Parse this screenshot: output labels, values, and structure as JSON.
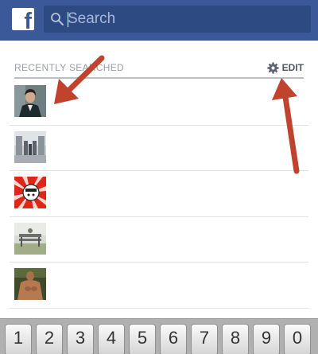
{
  "topbar": {
    "logo_letter": "f",
    "logo_icon": "facebook-logo-icon",
    "search": {
      "placeholder": "Search",
      "icon": "search-icon"
    }
  },
  "recent": {
    "title": "RECENTLY SEARCHED",
    "edit_label": "EDIT",
    "edit_icon": "gear-icon",
    "items": [
      {
        "thumbnail": "person-in-suit-photo"
      },
      {
        "thumbnail": "mirrored-street-photo"
      },
      {
        "thumbnail": "red-rays-cartoon-photo"
      },
      {
        "thumbnail": "outdoor-bench-photo"
      },
      {
        "thumbnail": "shirtless-person-photo"
      }
    ]
  },
  "keyboard": {
    "keys": [
      "1",
      "2",
      "3",
      "4",
      "5",
      "6",
      "7",
      "8",
      "9",
      "0"
    ]
  },
  "colors": {
    "topbar": "#3b5998",
    "search_box": "#2e4a82",
    "annotation_arrow": "#c0432e"
  }
}
